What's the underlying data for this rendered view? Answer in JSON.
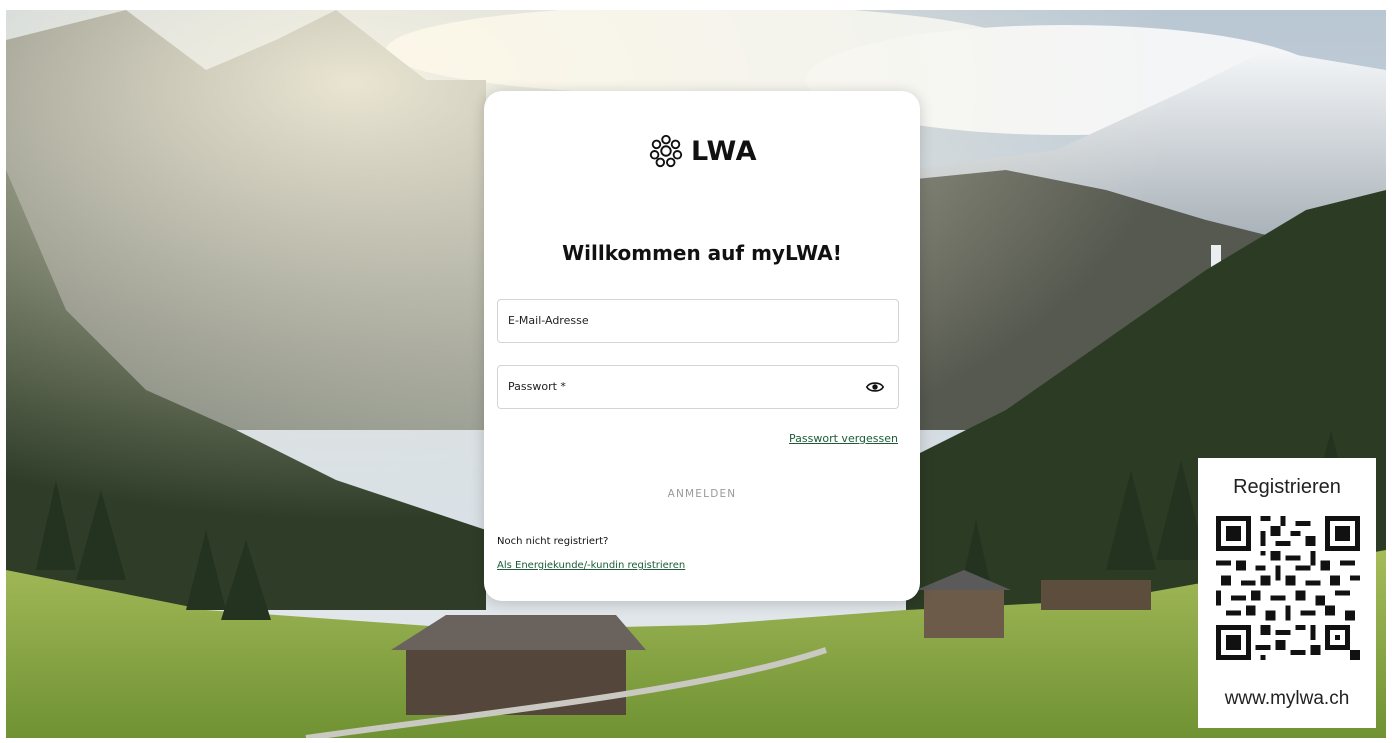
{
  "brand": {
    "name": "LWA",
    "logo_icon": "lwa-flower-icon"
  },
  "login": {
    "heading": "Willkommen auf myLWA!",
    "email_label": "E-Mail-Adresse",
    "password_label": "Passwort *",
    "password_toggle_icon": "eye-icon",
    "forgot_password": "Passwort vergessen",
    "submit_label": "ANMELDEN",
    "not_registered": "Noch nicht registriert?",
    "register_link": "Als Energiekunde/-kundin registrieren"
  },
  "promo": {
    "title": "Registrieren",
    "qr_icon": "qr-code-icon",
    "url": "www.mylwa.ch"
  },
  "colors": {
    "link": "#1d5c37",
    "button_text": "#9a9a9a"
  }
}
